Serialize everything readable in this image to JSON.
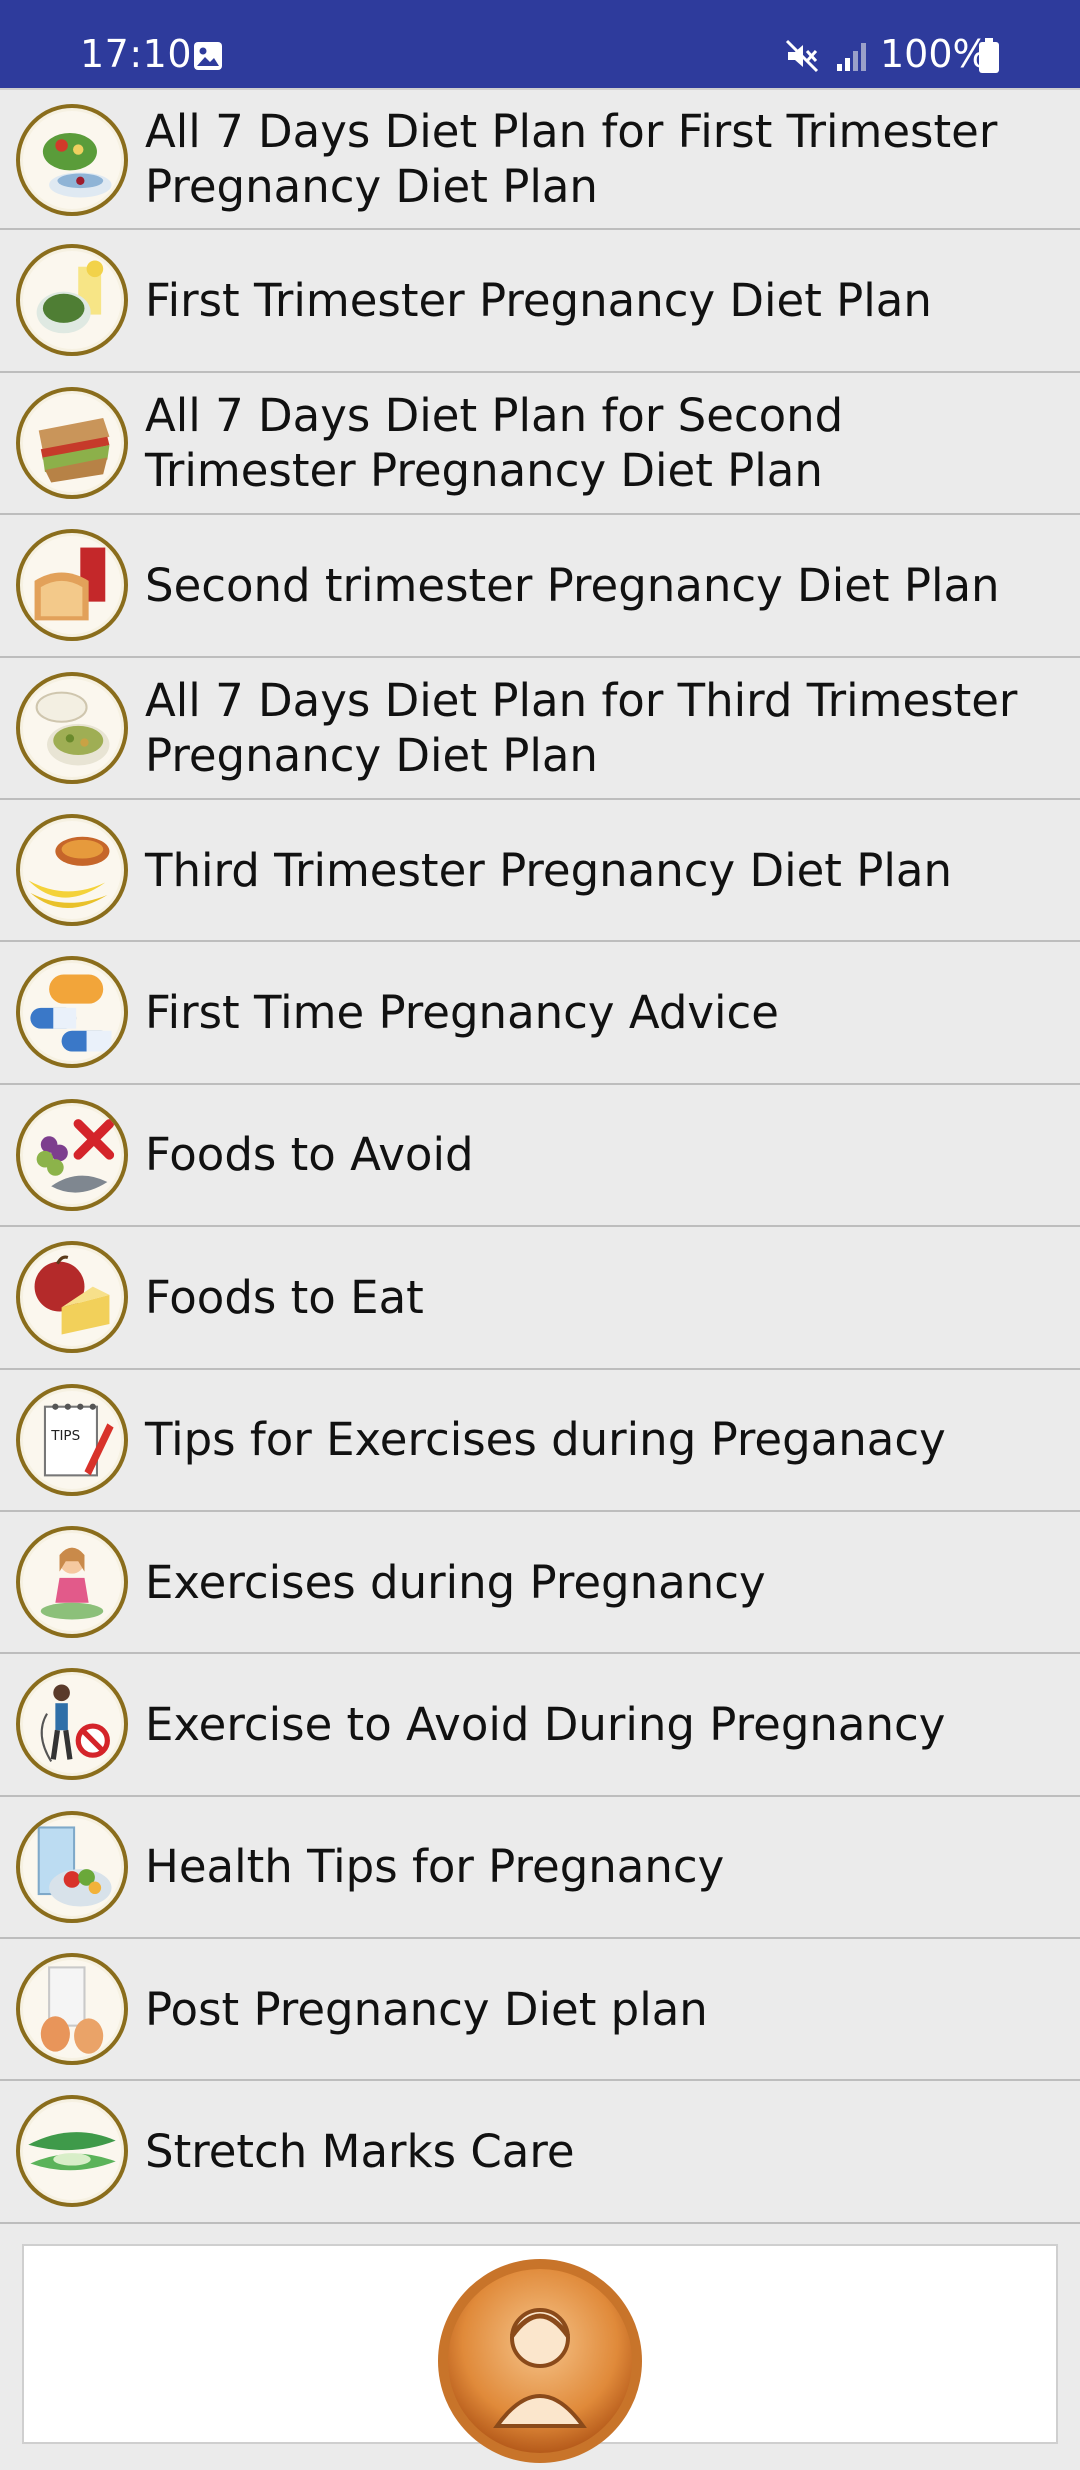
{
  "status_bar": {
    "time": "17:10",
    "battery": "100%",
    "icons": [
      "gallery-icon",
      "mute-icon",
      "signal-icon",
      "battery-icon"
    ]
  },
  "menu": {
    "items": [
      {
        "label": "All 7 Days Diet Plan for First Trimester Pregnancy Diet Plan",
        "icon": "salad-bowl-icon"
      },
      {
        "label": "First Trimester Pregnancy Diet Plan",
        "icon": "greens-juice-icon"
      },
      {
        "label": "All 7 Days Diet Plan for Second Trimester Pregnancy Diet Plan",
        "icon": "sandwich-icon"
      },
      {
        "label": "Second trimester Pregnancy Diet Plan",
        "icon": "bread-juice-icon"
      },
      {
        "label": "All 7 Days Diet Plan for Third Trimester Pregnancy Diet Plan",
        "icon": "yogurt-rice-icon"
      },
      {
        "label": "Third Trimester Pregnancy Diet Plan",
        "icon": "banana-soup-icon"
      },
      {
        "label": "First Time Pregnancy Advice",
        "icon": "pills-icon"
      },
      {
        "label": "Foods to Avoid",
        "icon": "grapes-fish-cross-icon"
      },
      {
        "label": "Foods to Eat",
        "icon": "apple-cheese-icon"
      },
      {
        "label": "Tips for Exercises during Preganacy",
        "icon": "tips-notepad-icon",
        "badge": "TIPS"
      },
      {
        "label": "Exercises during Pregnancy",
        "icon": "yoga-woman-icon"
      },
      {
        "label": "Exercise to Avoid During Pregnancy",
        "icon": "jump-rope-forbidden-icon"
      },
      {
        "label": "Health Tips for Pregnancy",
        "icon": "water-salad-icon"
      },
      {
        "label": "Post Pregnancy Diet plan",
        "icon": "milk-eggs-icon"
      },
      {
        "label": "Stretch Marks Care",
        "icon": "aloe-vera-icon"
      }
    ]
  },
  "bottom_card": {
    "icon": "profile-woman-icon"
  },
  "colors": {
    "status_bar": "#2e3b9c",
    "list_background": "#ebebeb",
    "icon_ring": "#8a6d1c"
  }
}
